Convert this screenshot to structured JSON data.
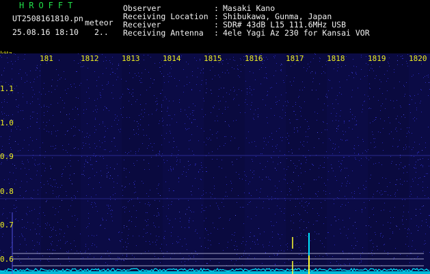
{
  "app": {
    "title": "HROFFT"
  },
  "file": {
    "name": "UT2508161810.pn",
    "tag": "meteor",
    "datetime": "25.08.16 18:10",
    "frame": "2.."
  },
  "info": [
    {
      "key": "Observer",
      "value": "Masaki Kano"
    },
    {
      "key": "Receiving Location",
      "value": "Shibukawa, Gunma, Japan"
    },
    {
      "key": "Receiver",
      "value": "SDR# 43dB L15 111.6MHz USB"
    },
    {
      "key": "Receiving Antenna",
      "value": "4ele Yagi Az 230 for Kansai VOR"
    }
  ],
  "axis": {
    "unit": "kHz",
    "freq_ticks": [
      "1.1",
      "1.0",
      "0.9",
      "0.8",
      "0.7",
      "0.6"
    ],
    "time_ticks": [
      "181",
      "1812",
      "1813",
      "1814",
      "1815",
      "1816",
      "1817",
      "1818",
      "1819",
      "1820"
    ]
  },
  "colors": {
    "background": "#000000",
    "noise": "#1a1a8c",
    "signal_low": "#00e5ff",
    "signal_high": "#ffff30",
    "axis_text": "#f0f020"
  }
}
